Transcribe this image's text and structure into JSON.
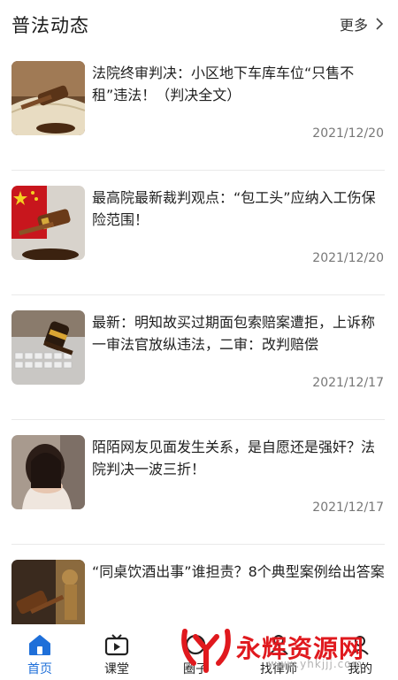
{
  "header": {
    "title": "普法动态",
    "more_label": "更多"
  },
  "articles": [
    {
      "title": "法院终审判决：小区地下车库车位“只售不租”违法！（判决全文）",
      "date": "2021/12/20",
      "thumb": "gavel-on-book-image"
    },
    {
      "title": "最高院最新裁判观点：“包工头”应纳入工伤保险范围！",
      "date": "2021/12/20",
      "thumb": "gavel-with-flag-image"
    },
    {
      "title": "最新：明知故买过期面包索赔案遭拒，上诉称一审法官放纵违法，二审：改判赔偿",
      "date": "2021/12/17",
      "thumb": "gavel-on-laptop-image"
    },
    {
      "title": "陌陌网友见面发生关系，是自愿还是强奸？法院判决一波三折！",
      "date": "2021/12/17",
      "thumb": "sad-woman-image"
    },
    {
      "title": "“同桌饮酒出事”谁担责？8个典型案例给出答案",
      "date": "",
      "thumb": "gavel-statue-image"
    }
  ],
  "tabs": [
    {
      "label": "首页",
      "icon": "home-icon",
      "active": true
    },
    {
      "label": "课堂",
      "icon": "tv-icon",
      "active": false
    },
    {
      "label": "圈子",
      "icon": "circle-icon",
      "active": false
    },
    {
      "label": "找律师",
      "icon": "lawyer-icon",
      "active": false
    },
    {
      "label": "我的",
      "icon": "user-icon",
      "active": false
    }
  ],
  "watermark": {
    "text": "永辉资源网",
    "url": "www.yhkjjj.com"
  },
  "colors": {
    "accent": "#1e6fd9",
    "watermark_red": "#e0191e"
  }
}
